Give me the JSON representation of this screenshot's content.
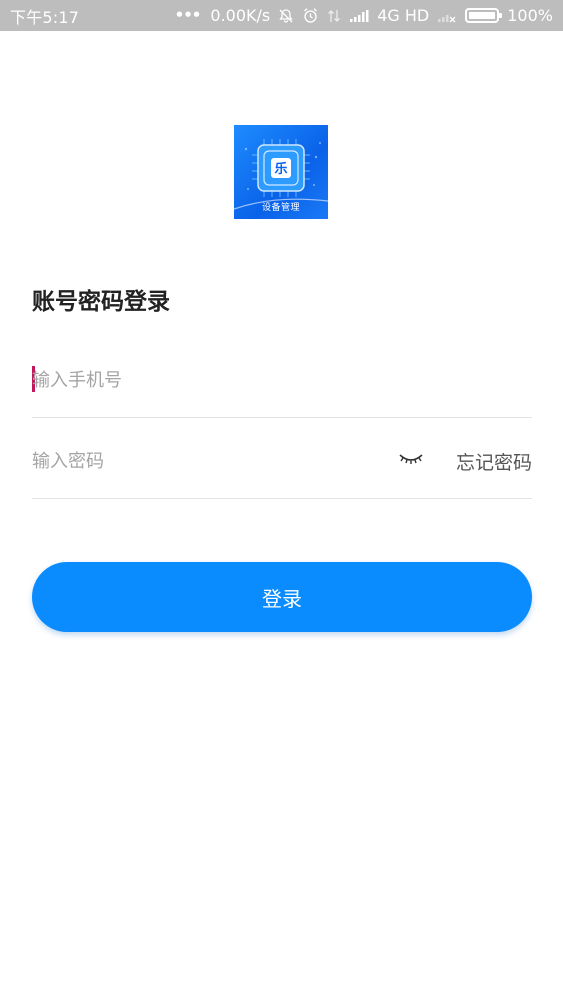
{
  "status_bar": {
    "time": "下午5:17",
    "speed": "0.00K/s",
    "network": "4G HD",
    "battery": "100%",
    "icons": [
      "more-dots-icon",
      "mute-bell-icon",
      "alarm-icon",
      "data-transfer-icon",
      "signal-icon",
      "no-signal-icon",
      "battery-icon"
    ]
  },
  "logo": {
    "text": "设备管理",
    "badge_char": "乐",
    "colors": {
      "primary": "#0a62e8",
      "light": "#1e8cff"
    }
  },
  "login": {
    "title": "账号密码登录",
    "phone_placeholder": "输入手机号",
    "password_placeholder": "输入密码",
    "forgot_label": "忘记密码",
    "submit_label": "登录",
    "eye_icon": "eye-closed-icon"
  },
  "colors": {
    "accent": "#0a8cff",
    "caret": "#c2185b",
    "divider": "#e3e3e3",
    "status_bar": "#bdbdbd"
  }
}
